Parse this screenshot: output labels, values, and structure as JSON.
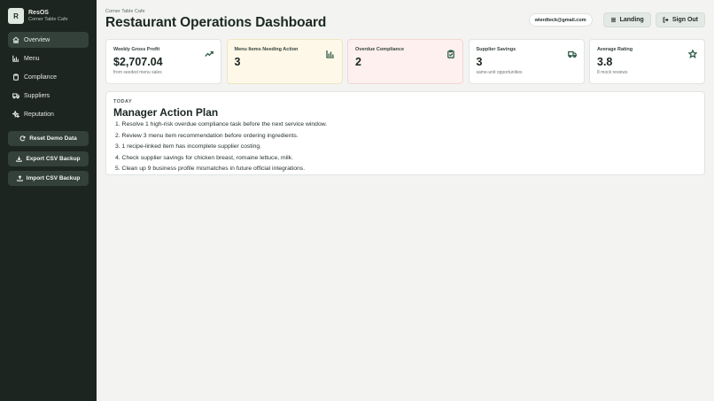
{
  "brand": {
    "logo_letter": "R",
    "name": "ResOS",
    "restaurant": "Corner Table Cafe"
  },
  "nav": {
    "items": [
      {
        "label": "Overview",
        "icon": "home-icon",
        "active": true
      },
      {
        "label": "Menu",
        "icon": "bar-chart-icon"
      },
      {
        "label": "Compliance",
        "icon": "clipboard-icon"
      },
      {
        "label": "Suppliers",
        "icon": "truck-icon"
      },
      {
        "label": "Reputation",
        "icon": "sparkle-icon"
      }
    ]
  },
  "sidebar_actions": {
    "reset": "Reset Demo Data",
    "export": "Export CSV Backup",
    "import": "Import CSV Backup"
  },
  "header": {
    "subtitle": "Corner Table Cafe",
    "title": "Restaurant Operations Dashboard"
  },
  "topbar": {
    "email": "wierdteck@gmail.com",
    "landing": "Landing",
    "sign_out": "Sign Out"
  },
  "cards": [
    {
      "label": "Weekly Gross Profit",
      "value": "$2,707.04",
      "note": "from seeded menu sales",
      "icon": "trending-up-icon"
    },
    {
      "label": "Menu Items Needing Action",
      "value": "3",
      "note": "",
      "icon": "bar-chart-icon"
    },
    {
      "label": "Overdue Compliance",
      "value": "2",
      "note": "",
      "icon": "clipboard-check-icon"
    },
    {
      "label": "Supplier Savings",
      "value": "3",
      "note": "same-unit opportunities",
      "icon": "truck-icon"
    },
    {
      "label": "Average Rating",
      "value": "3.8",
      "note": "8 mock reviews",
      "icon": "star-icon"
    }
  ],
  "plan": {
    "eyebrow": "TODAY",
    "title": "Manager Action Plan",
    "items": [
      "1. Resolve 1 high-risk overdue compliance task before the next service window.",
      "2. Review 3 menu item recommendation before ordering ingredients.",
      "3. 1 recipe-linked item has incomplete supplier costing.",
      "4. Check supplier savings for chicken breast, romaine lettuce, milk.",
      "5. Clean up 9 business profile mismatches in future official integrations."
    ]
  },
  "colors": {
    "sidebar_bg": "#1c2520",
    "accent": "#2f5d48",
    "warn_card": "#fdf8e8",
    "danger_card": "#fdf0ef"
  }
}
